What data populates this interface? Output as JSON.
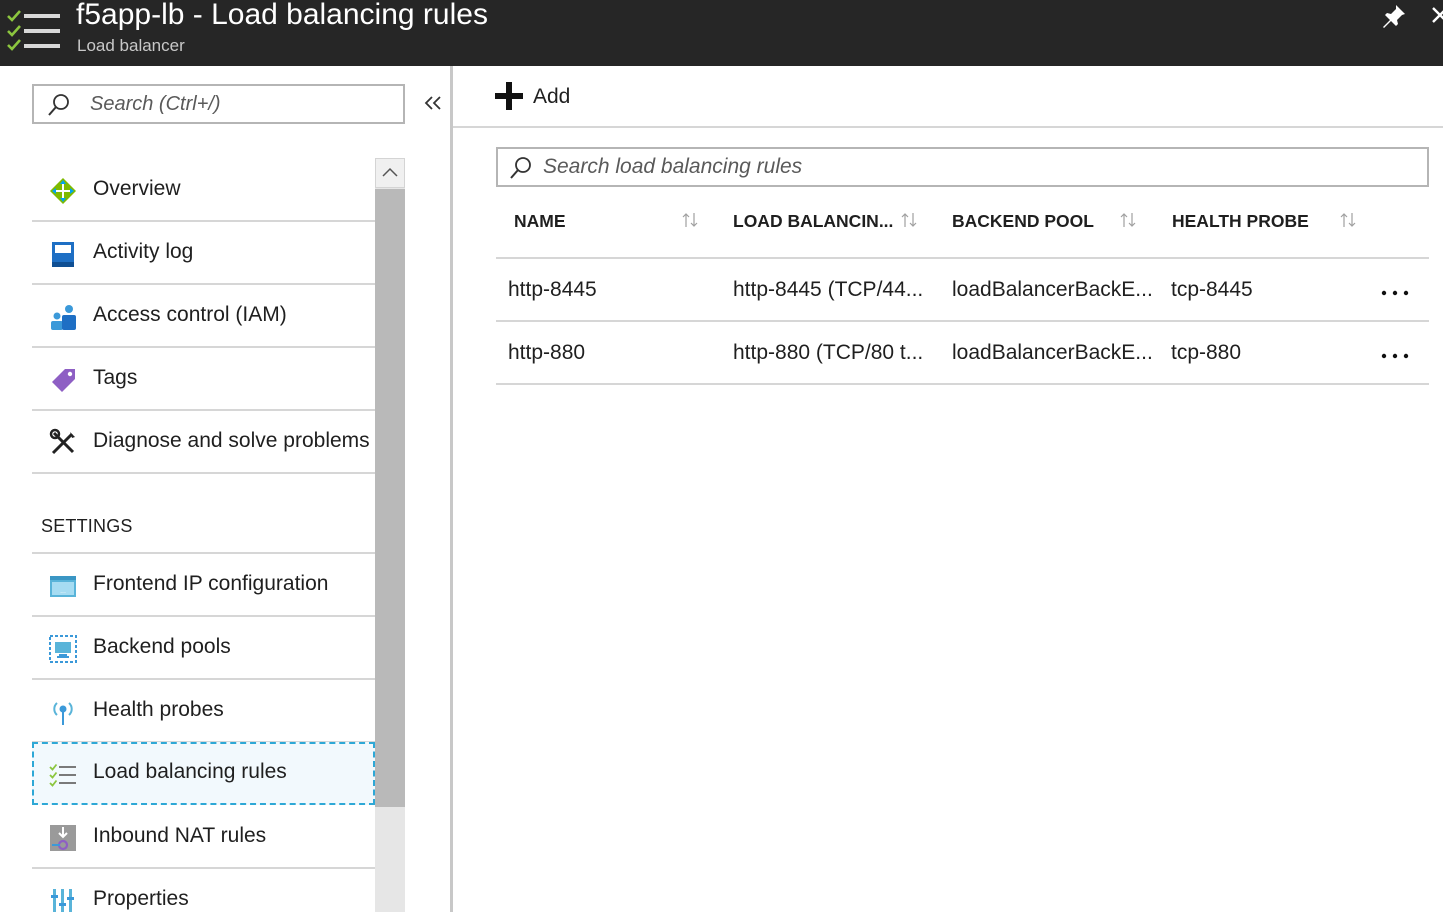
{
  "header": {
    "title": "f5app-lb - Load balancing rules",
    "subtitle": "Load balancer",
    "icon": "load-balancing-rules-icon"
  },
  "sidebar": {
    "search_placeholder": "Search (Ctrl+/)",
    "items": [
      {
        "label": "Overview",
        "icon": "overview-icon"
      },
      {
        "label": "Activity log",
        "icon": "activity-log-icon"
      },
      {
        "label": "Access control (IAM)",
        "icon": "iam-icon"
      },
      {
        "label": "Tags",
        "icon": "tag-icon"
      },
      {
        "label": "Diagnose and solve problems",
        "icon": "tools-icon"
      }
    ],
    "settings_heading": "SETTINGS",
    "settings_items": [
      {
        "label": "Frontend IP configuration",
        "icon": "frontend-ip-icon"
      },
      {
        "label": "Backend pools",
        "icon": "backend-pools-icon"
      },
      {
        "label": "Health probes",
        "icon": "health-probe-icon"
      },
      {
        "label": "Load balancing rules",
        "icon": "load-balancing-rules-icon",
        "selected": true
      },
      {
        "label": "Inbound NAT rules",
        "icon": "nat-rules-icon"
      },
      {
        "label": "Properties",
        "icon": "properties-icon"
      }
    ]
  },
  "toolbar": {
    "add_label": "Add"
  },
  "rules": {
    "search_placeholder": "Search load balancing rules",
    "columns": [
      "NAME",
      "LOAD BALANCIN...",
      "BACKEND POOL",
      "HEALTH PROBE"
    ],
    "rows": [
      {
        "name": "http-8445",
        "rule": "http-8445 (TCP/44...",
        "pool": "loadBalancerBackE...",
        "probe": "tcp-8445",
        "more": "..."
      },
      {
        "name": "http-880",
        "rule": "http-880 (TCP/80 t...",
        "pool": "loadBalancerBackE...",
        "probe": "tcp-880",
        "more": "..."
      }
    ]
  },
  "colors": {
    "header_bg": "#262626",
    "accent": "#2ea8d6",
    "selected_bg": "#f2f9fd",
    "check_green": "#8cc63f"
  }
}
